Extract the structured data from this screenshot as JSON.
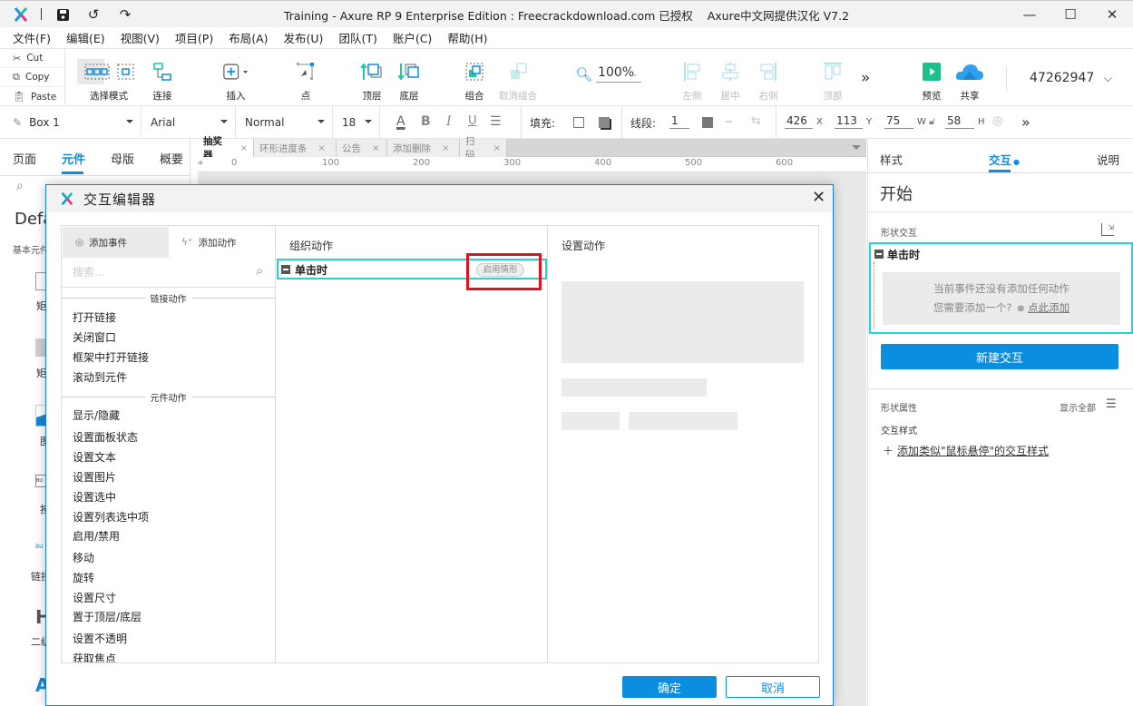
{
  "window": {
    "title": "Training - Axure RP 9 Enterprise Edition : Freecrackdownload.com 已授权",
    "title_suffix": "Axure中文网提供汉化 V7.2",
    "minimize": "—",
    "maximize": "☐",
    "close": "✕"
  },
  "menu": [
    "文件(F)",
    "编辑(E)",
    "视图(V)",
    "项目(P)",
    "布局(A)",
    "发布(U)",
    "团队(T)",
    "账户(C)",
    "帮助(H)"
  ],
  "clipboard": {
    "cut": "Cut",
    "copy": "Copy",
    "paste": "Paste"
  },
  "toolbar": {
    "select_mode": "选择模式",
    "connect": "连接",
    "insert": "插入",
    "point": "点",
    "top_layer": "顶层",
    "bottom_layer": "底层",
    "group": "组合",
    "ungroup": "取消组合",
    "zoom": "100%",
    "align_left": "左侧",
    "align_center": "居中",
    "align_right": "右侧",
    "align_top": "顶部",
    "more": "»",
    "preview": "预览",
    "share": "共享",
    "user_id": "47262947"
  },
  "format": {
    "element_name": "Box 1",
    "font": "Arial",
    "weight": "Normal",
    "size": "18",
    "fill_label": "填充:",
    "stroke_label": "线段:",
    "stroke_width": "1",
    "x": "426",
    "x_unit": "X",
    "y": "113",
    "y_unit": "Y",
    "w": "75",
    "w_unit": "W",
    "h": "58",
    "h_unit": "H"
  },
  "left_panel": {
    "tabs": [
      "页面",
      "元件",
      "母版",
      "概要"
    ],
    "active_tab": 1,
    "library": "Defa",
    "category": "基本元件",
    "widgets": [
      "矩",
      "矩",
      "图",
      "按",
      "链接",
      "二级",
      "A"
    ]
  },
  "doc_tabs": [
    {
      "label": "抽奖器",
      "active": true
    },
    {
      "label": "环形进度条",
      "active": false
    },
    {
      "label": "公告",
      "active": false
    },
    {
      "label": "添加删除",
      "active": false
    },
    {
      "label": "扫码",
      "active": false
    }
  ],
  "ruler": [
    "0",
    "100",
    "200",
    "300",
    "400",
    "500",
    "600"
  ],
  "right_panel": {
    "tabs": [
      "样式",
      "交互",
      "说明"
    ],
    "active_tab": 1,
    "heading": "开始",
    "shape_interactions": "形状交互",
    "event": "单击时",
    "empty_line1": "当前事件还没有添加任何动作",
    "empty_line2": "您需要添加一个?",
    "add_link": "点此添加",
    "new_interaction": "新建交互",
    "shape_props": "形状属性",
    "show_all": "显示全部",
    "interaction_styles": "交互样式",
    "add_style": "添加类似\"鼠标悬停\"的交互样式"
  },
  "dialog": {
    "title": "交互编辑器",
    "tab_add_event": "添加事件",
    "tab_add_action": "添加动作",
    "search_placeholder": "搜索...",
    "group_link": "链接动作",
    "link_actions": [
      "打开链接",
      "关闭窗口",
      "框架中打开链接",
      "滚动到元件"
    ],
    "group_widget": "元件动作",
    "widget_actions": [
      "显示/隐藏",
      "设置面板状态",
      "设置文本",
      "设置图片",
      "设置选中",
      "设置列表选中项",
      "启用/禁用",
      "移动",
      "旋转",
      "设置尺寸",
      "置于顶层/底层",
      "设置不透明",
      "获取焦点"
    ],
    "organize_title": "组织动作",
    "event": "单击时",
    "enable_case": "启用情形",
    "configure_title": "设置动作",
    "ok": "确定",
    "cancel": "取消"
  },
  "colors": {
    "accent": "#0c8ee0",
    "highlight": "#22d3d3",
    "annotation": "#e0141e"
  }
}
